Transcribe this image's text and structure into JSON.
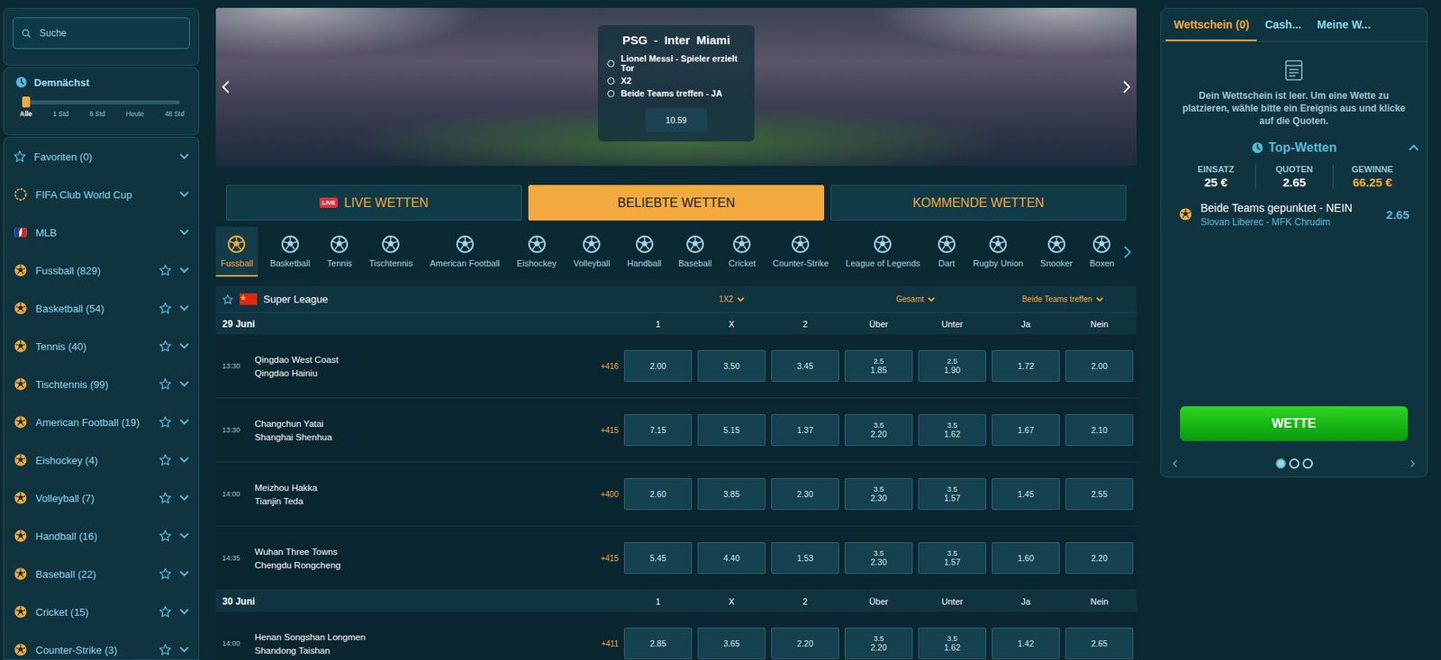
{
  "search": {
    "placeholder": "Suche"
  },
  "upcoming": {
    "title": "Demnächst",
    "level": 0,
    "ticks": [
      {
        "label": "Alle",
        "selected": true
      },
      {
        "label": "1 Std",
        "selected": false
      },
      {
        "label": "8 Std",
        "selected": false
      },
      {
        "label": "Heute",
        "selected": false
      },
      {
        "label": "48 Std",
        "selected": false
      }
    ]
  },
  "sidebar": {
    "items": [
      {
        "label": "Favoriten (0)",
        "kind": "favorites"
      },
      {
        "label": "FIFA Club World Cup",
        "kind": "competition"
      },
      {
        "label": "MLB",
        "kind": "league"
      },
      {
        "label": "Fussball (829)",
        "kind": "sport"
      },
      {
        "label": "Basketball (54)",
        "kind": "sport"
      },
      {
        "label": "Tennis (40)",
        "kind": "sport"
      },
      {
        "label": "Tischtennis (99)",
        "kind": "sport"
      },
      {
        "label": "American Football (19)",
        "kind": "sport"
      },
      {
        "label": "Eishockey (4)",
        "kind": "sport"
      },
      {
        "label": "Volleyball (7)",
        "kind": "sport"
      },
      {
        "label": "Handball (16)",
        "kind": "sport"
      },
      {
        "label": "Baseball (22)",
        "kind": "sport"
      },
      {
        "label": "Cricket (15)",
        "kind": "sport"
      },
      {
        "label": "Counter-Strike (3)",
        "kind": "sport"
      }
    ]
  },
  "banner": {
    "title": "PSG - Inter Miami",
    "selections": [
      "Lionel Messi - Spieler erzielt Tor",
      "X2",
      "Beide Teams treffen - JA"
    ],
    "odds": "10.59"
  },
  "main_tabs": [
    {
      "label": "LIVE WETTEN",
      "badge": "LIVE",
      "selected": false
    },
    {
      "label": "BELIEBTE WETTEN",
      "selected": true
    },
    {
      "label": "KOMMENDE WETTEN",
      "selected": false
    }
  ],
  "sports": [
    {
      "label": "Fussball",
      "selected": true
    },
    {
      "label": "Basketball",
      "selected": false
    },
    {
      "label": "Tennis",
      "selected": false
    },
    {
      "label": "Tischtennis",
      "selected": false
    },
    {
      "label": "American Football",
      "selected": false
    },
    {
      "label": "Eishockey",
      "selected": false
    },
    {
      "label": "Volleyball",
      "selected": false
    },
    {
      "label": "Handball",
      "selected": false
    },
    {
      "label": "Baseball",
      "selected": false
    },
    {
      "label": "Cricket",
      "selected": false
    },
    {
      "label": "Counter-Strike",
      "selected": false
    },
    {
      "label": "League of Legends",
      "selected": false
    },
    {
      "label": "Dart",
      "selected": false
    },
    {
      "label": "Rugby Union",
      "selected": false
    },
    {
      "label": "Snooker",
      "selected": false
    },
    {
      "label": "Boxen",
      "selected": false
    }
  ],
  "league": {
    "name": "Super League",
    "markets": [
      "1X2",
      "Gesamt",
      "Beide Teams treffen"
    ]
  },
  "days": [
    {
      "date": "29 Juni",
      "columns": [
        "1",
        "X",
        "2",
        "Über",
        "Unter",
        "Ja",
        "Nein"
      ],
      "matches": [
        {
          "time": "13:30",
          "home": "Qingdao West Coast",
          "away": "Qingdao Hainiu",
          "more": "+416",
          "cells": [
            {
              "value": "2.00"
            },
            {
              "value": "3.50"
            },
            {
              "value": "3.45"
            },
            {
              "line": "2.5",
              "value": "1.85"
            },
            {
              "line": "2.5",
              "value": "1.90"
            },
            {
              "value": "1.72"
            },
            {
              "value": "2.00"
            }
          ]
        },
        {
          "time": "13:30",
          "home": "Changchun Yatai",
          "away": "Shanghai Shenhua",
          "more": "+415",
          "cells": [
            {
              "value": "7.15"
            },
            {
              "value": "5.15"
            },
            {
              "value": "1.37"
            },
            {
              "line": "3.5",
              "value": "2.20"
            },
            {
              "line": "3.5",
              "value": "1.62"
            },
            {
              "value": "1.67"
            },
            {
              "value": "2.10"
            }
          ]
        },
        {
          "time": "14:00",
          "home": "Meizhou Hakka",
          "away": "Tianjin Teda",
          "more": "+400",
          "cells": [
            {
              "value": "2.60"
            },
            {
              "value": "3.85"
            },
            {
              "value": "2.30"
            },
            {
              "line": "3.5",
              "value": "2.30"
            },
            {
              "line": "3.5",
              "value": "1.57"
            },
            {
              "value": "1.45"
            },
            {
              "value": "2.55"
            }
          ]
        },
        {
          "time": "14:35",
          "home": "Wuhan Three Towns",
          "away": "Chengdu Rongcheng",
          "more": "+415",
          "cells": [
            {
              "value": "5.45"
            },
            {
              "value": "4.40"
            },
            {
              "value": "1.53"
            },
            {
              "line": "3.5",
              "value": "2.30"
            },
            {
              "line": "3.5",
              "value": "1.57"
            },
            {
              "value": "1.60"
            },
            {
              "value": "2.20"
            }
          ]
        }
      ]
    },
    {
      "date": "30 Juni",
      "columns": [
        "1",
        "X",
        "2",
        "Über",
        "Unter",
        "Ja",
        "Nein"
      ],
      "matches": [
        {
          "time": "14:00",
          "home": "Henan Songshan Longmen",
          "away": "Shandong Taishan",
          "more": "+411",
          "cells": [
            {
              "value": "2.85"
            },
            {
              "value": "3.65"
            },
            {
              "value": "2.20"
            },
            {
              "line": "3.5",
              "value": "2.20"
            },
            {
              "line": "3.5",
              "value": "1.62"
            },
            {
              "value": "1.42"
            },
            {
              "value": "2.65"
            }
          ]
        }
      ]
    }
  ],
  "betslip": {
    "tabs": [
      {
        "label": "Wettschein (0)",
        "selected": true
      },
      {
        "label": "Cash...",
        "selected": false
      },
      {
        "label": "Meine W...",
        "selected": false
      }
    ],
    "empty_text": "Dein Wettschein ist leer. Um eine Wette zu platzieren, wähle bitte ein Ereignis aus und klicke auf die Quoten.",
    "top": {
      "title": "Top-Wetten",
      "expanded": true,
      "stats": [
        {
          "label": "EINSATZ",
          "value": "25 €",
          "highlight": false
        },
        {
          "label": "QUOTEN",
          "value": "2.65",
          "highlight": false
        },
        {
          "label": "GEWINNE",
          "value": "66.25 €",
          "highlight": true
        }
      ],
      "bet": {
        "selection": "Beide Teams gepunktet - NEIN",
        "match": "Slovan Liberec - MFK Chrudim",
        "odds": "2.65"
      },
      "button": "WETTE",
      "pages": [
        {
          "selected": true
        },
        {
          "selected": false
        },
        {
          "selected": false
        }
      ]
    }
  }
}
